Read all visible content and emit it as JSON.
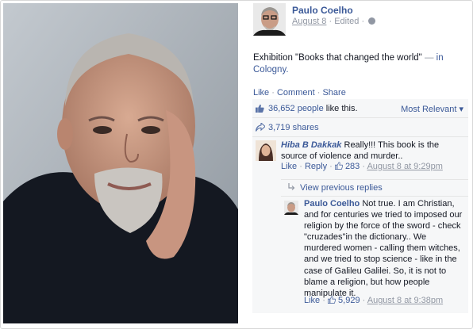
{
  "post": {
    "author": "Paulo Coelho",
    "date": "August 8",
    "edited": "Edited",
    "separator": "·",
    "text": "Exhibition \"Books that changed the world\"",
    "dash": "—",
    "in_word": "in",
    "location": "Cologny."
  },
  "actions": {
    "like": "Like",
    "comment": "Comment",
    "share": "Share",
    "sep": "·"
  },
  "ufi": {
    "likes_count": "36,652 people",
    "likes_suffix": "like this.",
    "sort_label": "Most Relevant",
    "sort_caret": "▾",
    "shares": "3,719 shares"
  },
  "comments": [
    {
      "name": "Hiba B Dakkak",
      "text": "Really!!! This book is the source of violence and murder..",
      "like": "Like",
      "reply": "Reply",
      "likes": "283",
      "time": "August 8 at 9:29pm"
    }
  ],
  "replies_toggle": "View previous replies",
  "reply": {
    "name": "Paulo Coelho",
    "text": "Not true. I am Christian, and for centuries we tried to imposed our religion by the force of the sword - check \"cruzades\"in the dictionary.. We murdered women - calling them witches, and we tried to stop science - like in the case of Galileu Galilei. So, it is not to blame a religion, but how people manipulate it.",
    "like": "Like",
    "likes": "5,929",
    "time": "August 8 at 9:38pm"
  },
  "colors": {
    "link": "#3b5998",
    "meta": "#9197a3",
    "ufi_bg": "#f6f7f8"
  }
}
